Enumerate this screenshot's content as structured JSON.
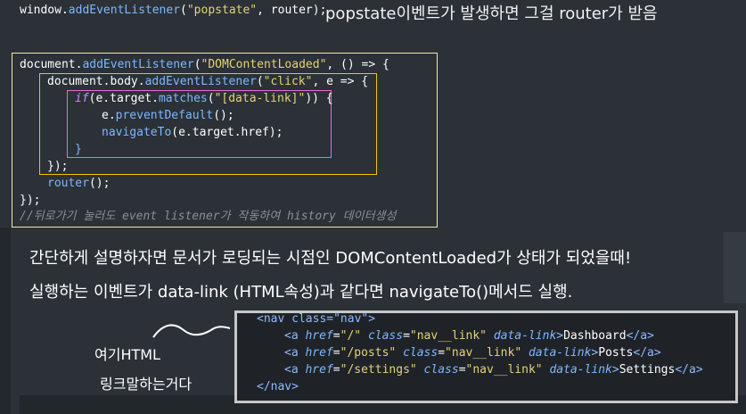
{
  "top": {
    "code_line": "window.addEventListener(\"popstate\", router);",
    "code_obj": "window.",
    "code_fn": "addEventListener",
    "code_str": "\"popstate\"",
    "code_rest": ", router);",
    "note": "popstate이벤트가 발생하면 그걸 router가 받음"
  },
  "code": {
    "l1a": "document.",
    "l1fn": "addEventListener",
    "l1str": "\"DOMContentLoaded\"",
    "l1rest": ", () => {",
    "l2a": "document.body.",
    "l2fn": "addEventListener",
    "l2str": "\"click\"",
    "l2rest": ", e => {",
    "l3kw": "if",
    "l3a": "(e.target.",
    "l3fn": "matches",
    "l3str": "\"[data-link]\"",
    "l3rest": ")) {",
    "l4a": "e.",
    "l4fn": "preventDefault",
    "l4rest": "();",
    "l5fn": "navigateTo",
    "l5rest": "(e.target.href);",
    "l6": "}",
    "l7": "});",
    "l8fn": "router",
    "l8rest": "();",
    "l9": "});",
    "comment": "//뒤로가기 눌러도 event listener가 작동하여 history 데이터생성"
  },
  "explanation": {
    "line1": "간단하게 설명하자면 문서가 로딩되는 시점인 DOMContentLoaded가 상태가 되었을때!",
    "line2": "실행하는 이벤트가 data-link (HTML속성)과 같다면 navigateTo()메서드 실행."
  },
  "html_snippet": {
    "nav_open": "<nav class=\"nav\">",
    "links": [
      {
        "href": "\"/\"",
        "text": "Dashboard"
      },
      {
        "href": "\"/posts\"",
        "text": "Posts"
      },
      {
        "href": "\"/settings\"",
        "text": "Settings"
      }
    ],
    "class_val": "\"nav__link\"",
    "nav_close": "</nav>"
  },
  "handwriting": {
    "line1": "여기HTML",
    "line2": "링크말하는거다"
  },
  "colors": {
    "background": "#2b3137",
    "frame_outer": "#f3e7a8",
    "frame_yellow": "#f0c400",
    "frame_pink": "#e36fd7",
    "html_frame": "#c7c7c7"
  }
}
